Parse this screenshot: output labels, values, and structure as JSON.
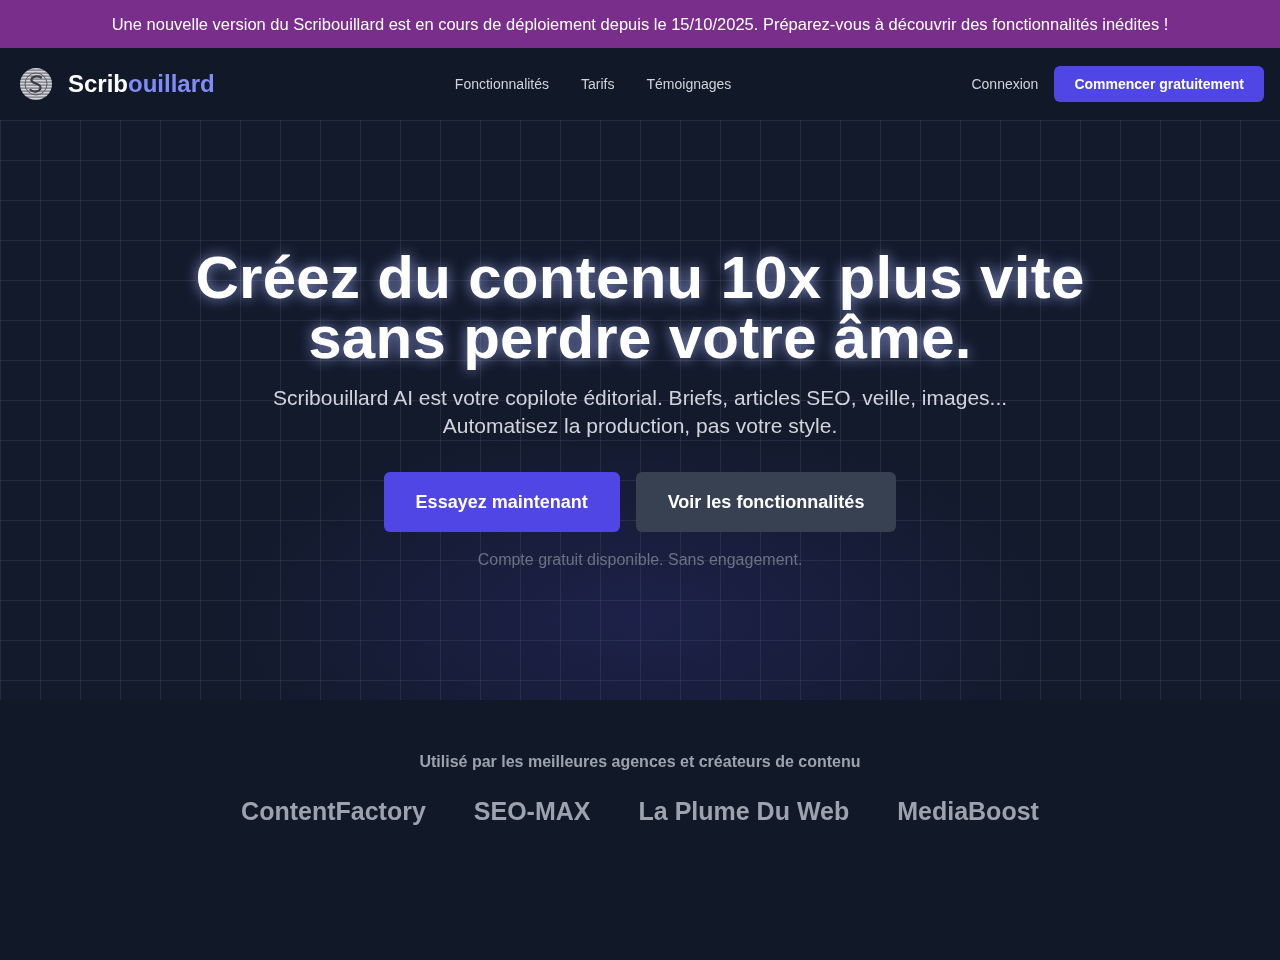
{
  "announcement": {
    "text": "Une nouvelle version du Scribouillard est en cours de déploiement depuis le 15/10/2025. Préparez-vous à découvrir des fonctionnalités inédites !"
  },
  "navbar": {
    "brand": {
      "lead": "Scrib",
      "accent": "ouillard"
    },
    "links": [
      "Fonctionnalités",
      "Tarifs",
      "Témoignages"
    ],
    "login": "Connexion",
    "cta": "Commencer gratuitement"
  },
  "hero": {
    "title_lines": [
      "Créez du contenu 10x plus vite",
      "sans perdre votre âme."
    ],
    "subtitle_lines": [
      "Scribouillard AI est votre copilote éditorial. Briefs, articles SEO, veille, images...",
      "Automatisez la production, pas votre style."
    ],
    "buttons": [
      {
        "label": "Essayez maintenant",
        "kind": "primary"
      },
      {
        "label": "Voir les fonctionnalités",
        "kind": "secondary"
      }
    ],
    "note": "Compte gratuit disponible. Sans engagement."
  },
  "clients": {
    "heading": "Utilisé par les meilleures agences et créateurs de contenu",
    "logos": [
      "ContentFactory",
      "SEO-MAX",
      "La Plume Du Web",
      "MediaBoost"
    ]
  }
}
